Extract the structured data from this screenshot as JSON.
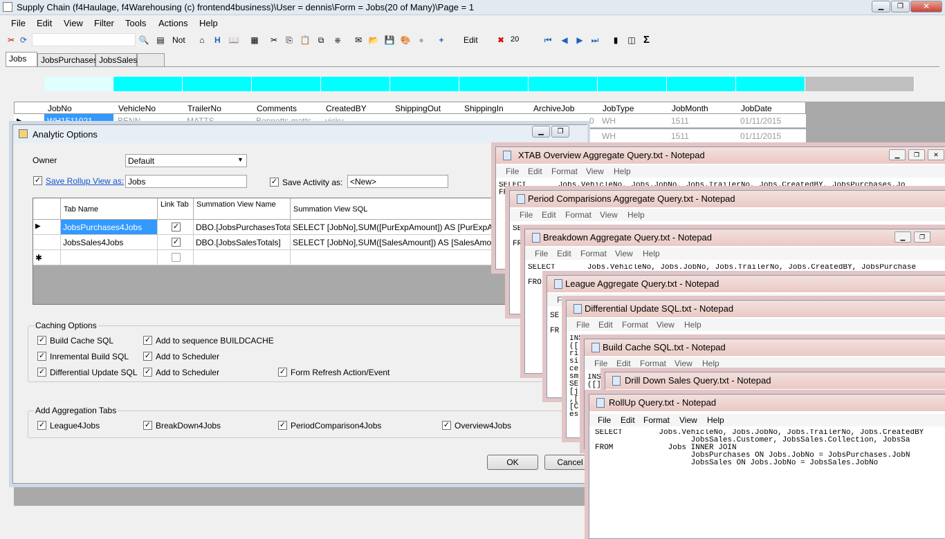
{
  "app": {
    "title": "Supply Chain (f4Haulage, f4Warehousing (c) frontend4business)\\User = dennis\\Form = Jobs(20 of Many)\\Page = 1"
  },
  "menu": [
    "File",
    "Edit",
    "View",
    "Filter",
    "Tools",
    "Actions",
    "Help"
  ],
  "toolbar": {
    "not_label": "Not",
    "h_label": "H",
    "edit_label": "Edit",
    "count_value": "20",
    "sigma": "Σ"
  },
  "tabs": [
    "Jobs",
    "JobsPurchases",
    "JobsSales"
  ],
  "grid": {
    "columns": [
      "JobNo",
      "VehicleNo",
      "TrailerNo",
      "Comments",
      "CreatedBY",
      "ShippingOut",
      "ShippingIn",
      "ArchiveJob",
      "JobType",
      "JobMonth",
      "JobDate"
    ],
    "rows": [
      {
        "jobno": "WH1511021",
        "vehicle": "BENN",
        "trailer": "MATTS",
        "comments": "Bennetts matts",
        "createdby": "vicky",
        "archive": "0",
        "jobtype": "WH",
        "month": "1511",
        "date": "01/11/2015"
      },
      {
        "jobno": "",
        "vehicle": "",
        "trailer": "",
        "comments": "",
        "createdby": "",
        "archive": "",
        "jobtype": "WH",
        "month": "1511",
        "date": "01/11/2015"
      }
    ]
  },
  "dialog": {
    "title": "Analytic Options",
    "owner_label": "Owner",
    "owner_value": "Default",
    "save_rollup_label": "Save Rollup View as:",
    "save_rollup_value": "Jobs",
    "save_activity_label": "Save Activity as:",
    "save_activity_value": "<New>",
    "tab_grid": {
      "headers": [
        "Tab Name",
        "Link Tab",
        "Summation View Name",
        "Summation View SQL"
      ],
      "rows": [
        {
          "name": "JobsPurchases4Jobs",
          "view": "DBO.[JobsPurchasesTota...",
          "sql": "SELECT [JobNo],SUM([PurExpAmount]) AS [PurExpAmount],S"
        },
        {
          "name": "JobsSales4Jobs",
          "view": "DBO.[JobsSalesTotals]",
          "sql": "SELECT [JobNo],SUM([SalesAmount]) AS [SalesAmount],SUM"
        }
      ],
      "new_row_marker": "✱"
    },
    "caching": {
      "title": "Caching Options",
      "items": [
        "Build Cache SQL",
        "Add to sequence BUILDCACHE",
        "Inremental Build SQL",
        "Add to Scheduler",
        "Differential Update SQL",
        "Add to Scheduler",
        "Form Refresh Action/Event"
      ]
    },
    "aggregation": {
      "title": "Add Aggregation Tabs",
      "items": [
        "League4Jobs",
        "BreakDown4Jobs",
        "PeriodComparison4Jobs",
        "Overview4Jobs"
      ]
    },
    "ok_label": "OK",
    "cancel_label": "Cancel"
  },
  "notepad_menu": [
    "File",
    "Edit",
    "Format",
    "View",
    "Help"
  ],
  "notepads": [
    {
      "title": "XTAB Overview Aggregate Query.txt - Notepad",
      "body": "SELECT       Jobs.VehicleNo, Jobs.JobNo, Jobs.TrailerNo, Jobs.CreatedBY, JobsPurchases.Jo\nFR"
    },
    {
      "title": "Period Comparisions Aggregate Query.txt - Notepad",
      "body": "SE\n\nFR"
    },
    {
      "title": "Breakdown Aggregate Query.txt - Notepad",
      "body": "SELECT       Jobs.VehicleNo, Jobs.JobNo, Jobs.TrailerNo, Jobs.CreatedBY, JobsPurchase\n\nFRO"
    },
    {
      "title": "League Aggregate Query.txt - Notepad",
      "body": "\nSE\n\nFR"
    },
    {
      "title": "Differential Update SQL.txt - Notepad",
      "body": "INS\n([\nri\nsi\nce\nsm\nSE\n[j\n,[\n[C\nes"
    },
    {
      "title": "Build Cache SQL.txt - Notepad",
      "body": "INS\n([]"
    },
    {
      "title": "Drill Down Sales Query.txt - Notepad",
      "body": ""
    },
    {
      "title": "RollUp Query.txt - Notepad",
      "body": "SELECT        Jobs.VehicleNo, Jobs.JobNo, Jobs.TrailerNo, Jobs.CreatedBY\n                     JobsSales.Customer, JobsSales.Collection, JobsSa\nFROM            Jobs INNER JOIN\n                     JobsPurchases ON Jobs.JobNo = JobsPurchases.JobN\n                     JobsSales ON Jobs.JobNo = JobsSales.JobNo"
    }
  ],
  "colors": {
    "cyan": "#00ffff",
    "light_cyan": "#e0ffff",
    "selection": "#3399ff"
  }
}
